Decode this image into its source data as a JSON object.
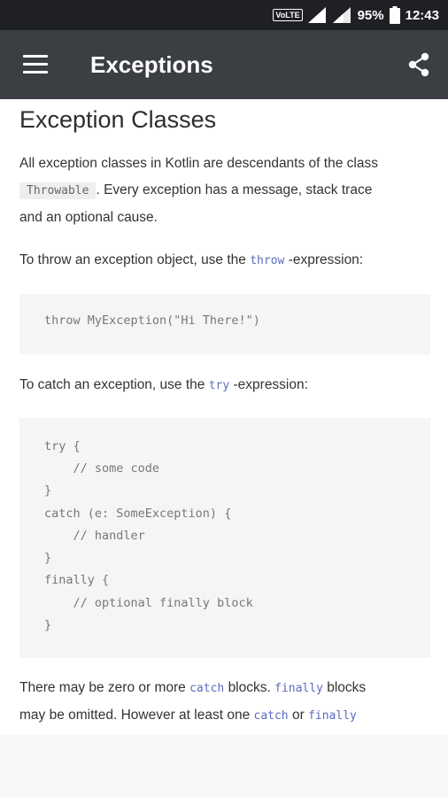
{
  "status": {
    "volte": "VoLTE",
    "battery": "95%",
    "time": "12:43"
  },
  "appbar": {
    "title": "Exceptions",
    "menu_icon": "menu-icon",
    "share_icon": "share-icon"
  },
  "article": {
    "heading": "Exception Classes",
    "p1": {
      "before": "All exception classes in Kotlin are descendants of the class",
      "code": "Throwable",
      "after1": ". Every exception has a message, stack trace",
      "after2": "and an optional cause."
    },
    "p2": {
      "before": "To throw an exception object, use the",
      "code": "throw",
      "after": "-expression:"
    },
    "code1": [
      "throw MyException(\"Hi There!\")"
    ],
    "p3": {
      "before": "To catch an exception, use the",
      "code": "try",
      "after": "-expression:"
    },
    "code2": [
      "try {",
      "    // some code",
      "}",
      "catch (e: SomeException) {",
      "    // handler",
      "}",
      "finally {",
      "    // optional finally block",
      "}"
    ],
    "p4": {
      "l1_before": "There may be zero or more",
      "l1_code1": "catch",
      "l1_mid": "blocks.",
      "l1_code2": "finally",
      "l1_after": "blocks",
      "l2_before": "may be omitted. However at least one",
      "l2_code1": "catch",
      "l2_mid": "or",
      "l2_code2": "finally"
    }
  }
}
